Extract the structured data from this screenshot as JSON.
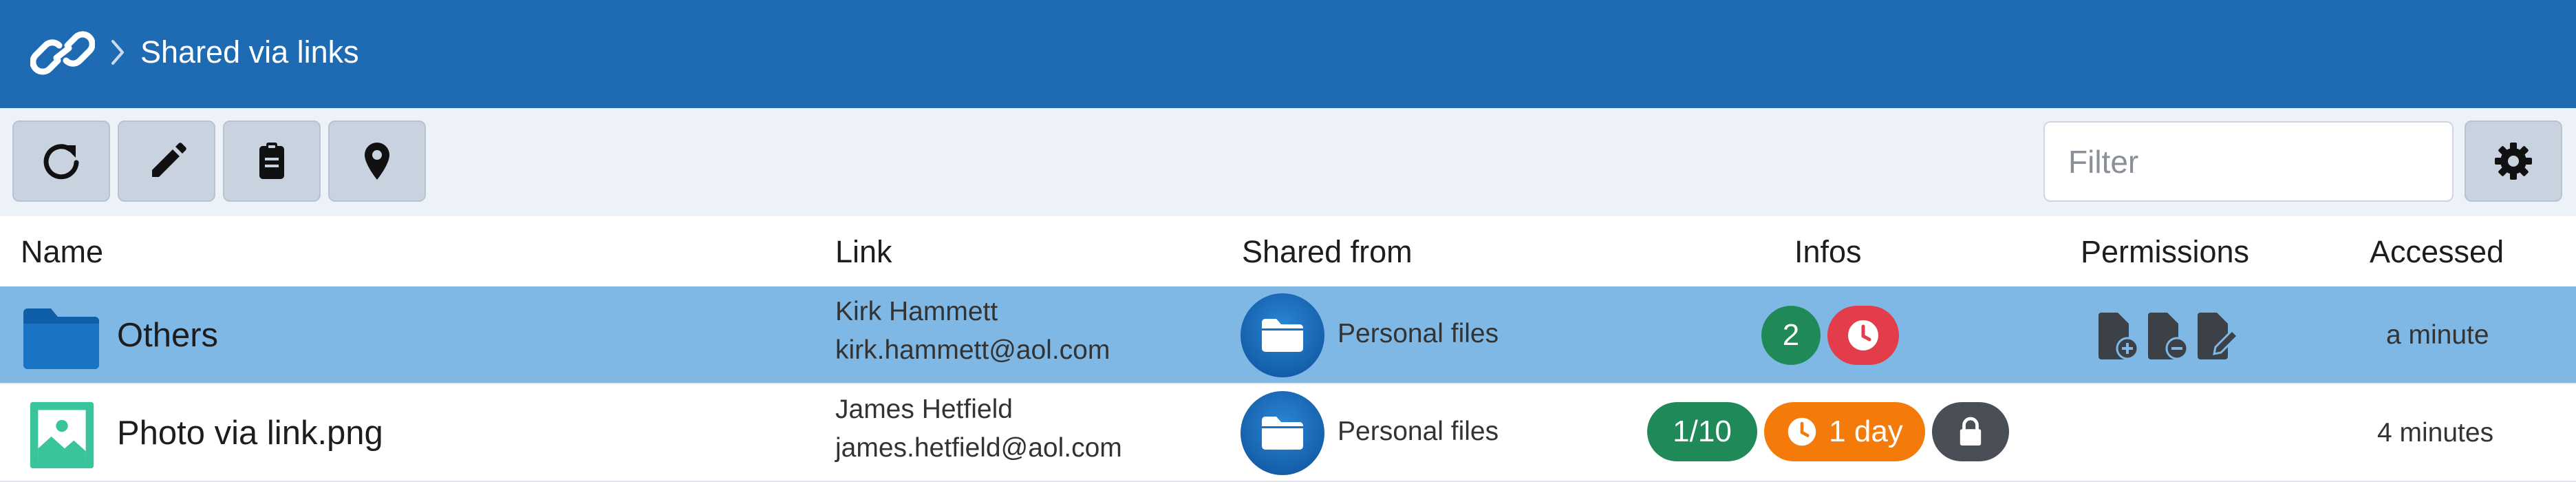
{
  "header": {
    "title": "Shared via links",
    "logo_icon": "link-icon",
    "separator_icon": "chevron-right-icon"
  },
  "toolbar": {
    "buttons": [
      {
        "name": "refresh",
        "icon": "refresh-icon"
      },
      {
        "name": "edit",
        "icon": "pencil-icon"
      },
      {
        "name": "clipboard",
        "icon": "clipboard-icon"
      },
      {
        "name": "location",
        "icon": "map-pin-icon"
      }
    ],
    "filter_placeholder": "Filter",
    "filter_value": "",
    "settings_icon": "gear-icon"
  },
  "columns": {
    "name": "Name",
    "link": "Link",
    "shared_from": "Shared from",
    "infos": "Infos",
    "permissions": "Permissions",
    "accessed": "Accessed"
  },
  "rows": [
    {
      "name": "Others",
      "type_icon": "folder-icon",
      "selected": true,
      "link_name": "Kirk Hammett",
      "link_email": "kirk.hammett@aol.com",
      "shared_from": "Personal files",
      "info_count": "2",
      "info_icon": "clock-icon",
      "permissions": [
        "file-add-icon",
        "file-remove-icon",
        "file-edit-icon"
      ],
      "accessed": "a minute"
    },
    {
      "name": "Photo via link.png",
      "type_icon": "image-file-icon",
      "selected": false,
      "link_name": "James Hetfield",
      "link_email": "james.hetfield@aol.com",
      "shared_from": "Personal files",
      "info_count": "1/10",
      "info_expiry": "1 day",
      "info_lock_icon": "lock-icon",
      "accessed": "4 minutes"
    }
  ],
  "colors": {
    "header": "#1f6bb3",
    "selected_row": "#7fb8e4",
    "badge_green": "#1f8a57",
    "badge_red": "#e33c4b",
    "badge_orange": "#f47b0a",
    "badge_gray": "#4a4f57"
  }
}
